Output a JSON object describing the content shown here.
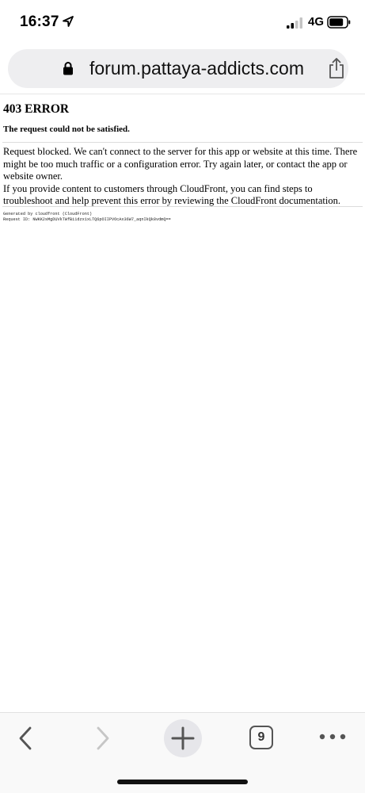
{
  "status_bar": {
    "time": "16:37",
    "network": "4G"
  },
  "url_bar": {
    "url": "forum.pattaya-addicts.com"
  },
  "error_page": {
    "title": "403 ERROR",
    "subtitle": "The request could not be satisfied.",
    "body_paragraph_1": "Request blocked. We can't connect to the server for this app or website at this time. There might be too much traffic or a configuration error. Try again later, or contact the app or website owner.",
    "body_paragraph_2": "If you provide content to customers through CloudFront, you can find steps to troubleshoot and help prevent this error by reviewing the CloudFront documentation.",
    "generated_by": "Generated by cloudfront (CloudFront)",
    "request_id": "Request ID: NWKK2sMgDUVkTWfBi1dzx1xLTQ6pOIIPVOcAx36W7_aqnIkQk8vdmQ=="
  },
  "toolbar": {
    "tab_count": "9"
  }
}
